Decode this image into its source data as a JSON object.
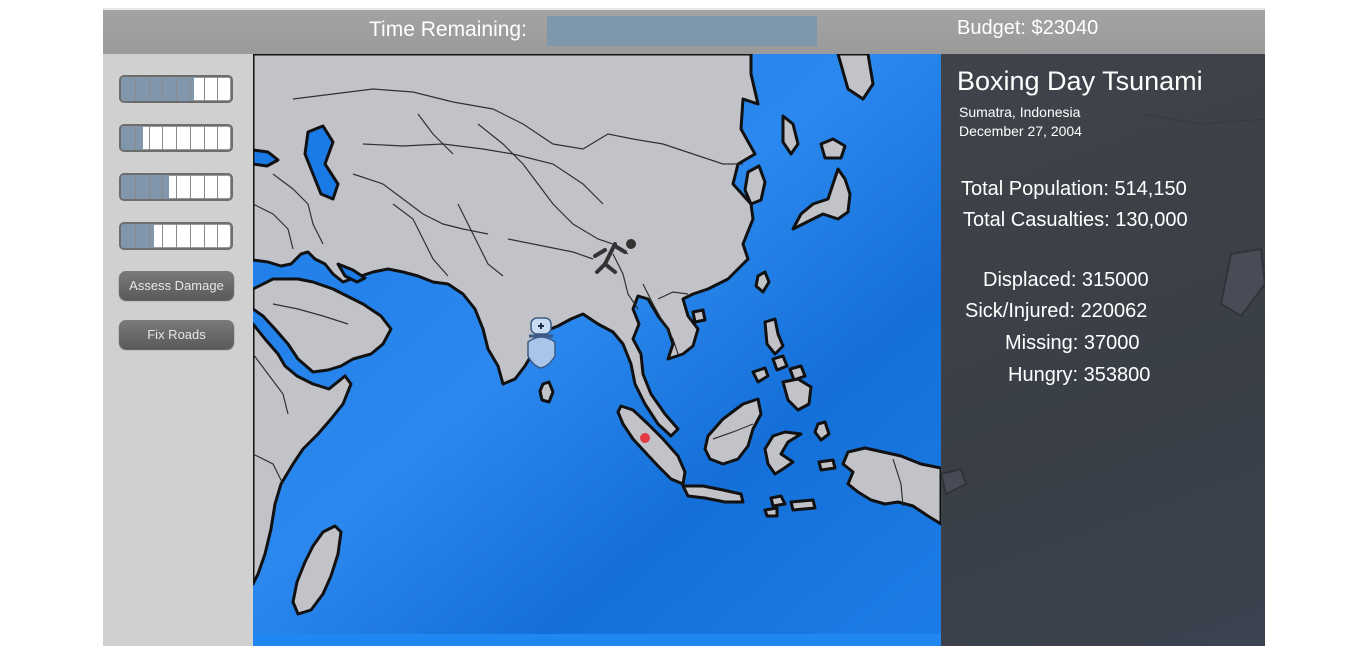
{
  "header": {
    "time_label": "Time Remaining:",
    "time_remaining_fraction": 1.0,
    "budget": "Budget: $23040"
  },
  "meters": [
    {
      "fill": 0.66
    },
    {
      "fill": 0.2
    },
    {
      "fill": 0.44
    },
    {
      "fill": 0.3
    }
  ],
  "buttons": {
    "assess_damage": "Assess Damage",
    "fix_roads": "Fix Roads"
  },
  "disaster": {
    "title": "Boxing Day Tsunami",
    "location": "Sumatra, Indonesia",
    "date": "December 27, 2004"
  },
  "stats": {
    "total_population": "Total Population: 514,150",
    "total_casualties": "Total Casualties: 130,000",
    "displaced": "Displaced: 315000",
    "sick_injured": "Sick/Injured: 220062",
    "missing": "Missing: 37000",
    "hungry": "Hungry: 353800"
  },
  "colors": {
    "ocean": "#1a7ae6",
    "land": "#c2c3c8",
    "time_bar": "#7f97ad",
    "panel": "#3f434a",
    "marker": "#e8202a"
  },
  "map_icons": [
    "runner-icon",
    "medic-icon",
    "epicenter-marker"
  ]
}
